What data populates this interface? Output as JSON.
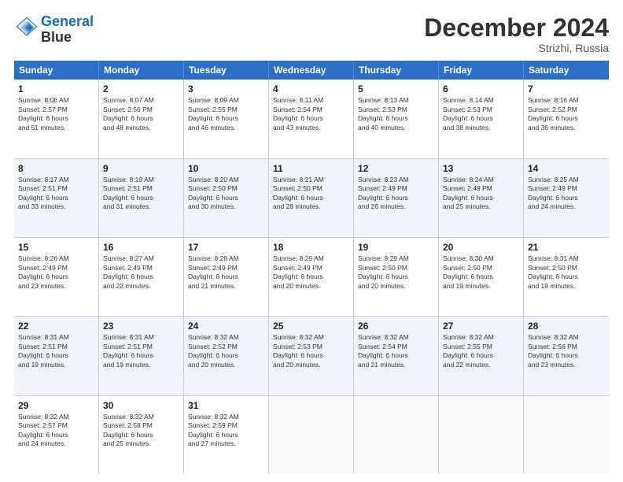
{
  "logo": {
    "line1": "General",
    "line2": "Blue"
  },
  "title": "December 2024",
  "location": "Strizhi, Russia",
  "days_of_week": [
    "Sunday",
    "Monday",
    "Tuesday",
    "Wednesday",
    "Thursday",
    "Friday",
    "Saturday"
  ],
  "weeks": [
    [
      {
        "day": "1",
        "info": "Sunrise: 8:06 AM\nSunset: 2:57 PM\nDaylight: 6 hours\nand 51 minutes."
      },
      {
        "day": "2",
        "info": "Sunrise: 8:07 AM\nSunset: 2:56 PM\nDaylight: 6 hours\nand 48 minutes."
      },
      {
        "day": "3",
        "info": "Sunrise: 8:09 AM\nSunset: 2:55 PM\nDaylight: 6 hours\nand 46 minutes."
      },
      {
        "day": "4",
        "info": "Sunrise: 8:11 AM\nSunset: 2:54 PM\nDaylight: 6 hours\nand 43 minutes."
      },
      {
        "day": "5",
        "info": "Sunrise: 8:13 AM\nSunset: 2:53 PM\nDaylight: 6 hours\nand 40 minutes."
      },
      {
        "day": "6",
        "info": "Sunrise: 8:14 AM\nSunset: 2:53 PM\nDaylight: 6 hours\nand 38 minutes."
      },
      {
        "day": "7",
        "info": "Sunrise: 8:16 AM\nSunset: 2:52 PM\nDaylight: 6 hours\nand 36 minutes."
      }
    ],
    [
      {
        "day": "8",
        "info": "Sunrise: 8:17 AM\nSunset: 2:51 PM\nDaylight: 6 hours\nand 33 minutes."
      },
      {
        "day": "9",
        "info": "Sunrise: 8:19 AM\nSunset: 2:51 PM\nDaylight: 6 hours\nand 31 minutes."
      },
      {
        "day": "10",
        "info": "Sunrise: 8:20 AM\nSunset: 2:50 PM\nDaylight: 6 hours\nand 30 minutes."
      },
      {
        "day": "11",
        "info": "Sunrise: 8:21 AM\nSunset: 2:50 PM\nDaylight: 6 hours\nand 28 minutes."
      },
      {
        "day": "12",
        "info": "Sunrise: 8:23 AM\nSunset: 2:49 PM\nDaylight: 6 hours\nand 26 minutes."
      },
      {
        "day": "13",
        "info": "Sunrise: 8:24 AM\nSunset: 2:49 PM\nDaylight: 6 hours\nand 25 minutes."
      },
      {
        "day": "14",
        "info": "Sunrise: 8:25 AM\nSunset: 2:49 PM\nDaylight: 6 hours\nand 24 minutes."
      }
    ],
    [
      {
        "day": "15",
        "info": "Sunrise: 8:26 AM\nSunset: 2:49 PM\nDaylight: 6 hours\nand 23 minutes."
      },
      {
        "day": "16",
        "info": "Sunrise: 8:27 AM\nSunset: 2:49 PM\nDaylight: 6 hours\nand 22 minutes."
      },
      {
        "day": "17",
        "info": "Sunrise: 8:28 AM\nSunset: 2:49 PM\nDaylight: 6 hours\nand 21 minutes."
      },
      {
        "day": "18",
        "info": "Sunrise: 8:29 AM\nSunset: 2:49 PM\nDaylight: 6 hours\nand 20 minutes."
      },
      {
        "day": "19",
        "info": "Sunrise: 8:29 AM\nSunset: 2:50 PM\nDaylight: 6 hours\nand 20 minutes."
      },
      {
        "day": "20",
        "info": "Sunrise: 8:30 AM\nSunset: 2:50 PM\nDaylight: 6 hours\nand 19 minutes."
      },
      {
        "day": "21",
        "info": "Sunrise: 8:31 AM\nSunset: 2:50 PM\nDaylight: 6 hours\nand 19 minutes."
      }
    ],
    [
      {
        "day": "22",
        "info": "Sunrise: 8:31 AM\nSunset: 2:51 PM\nDaylight: 6 hours\nand 19 minutes."
      },
      {
        "day": "23",
        "info": "Sunrise: 8:31 AM\nSunset: 2:51 PM\nDaylight: 6 hours\nand 19 minutes."
      },
      {
        "day": "24",
        "info": "Sunrise: 8:32 AM\nSunset: 2:52 PM\nDaylight: 6 hours\nand 20 minutes."
      },
      {
        "day": "25",
        "info": "Sunrise: 8:32 AM\nSunset: 2:53 PM\nDaylight: 6 hours\nand 20 minutes."
      },
      {
        "day": "26",
        "info": "Sunrise: 8:32 AM\nSunset: 2:54 PM\nDaylight: 6 hours\nand 21 minutes."
      },
      {
        "day": "27",
        "info": "Sunrise: 8:32 AM\nSunset: 2:55 PM\nDaylight: 6 hours\nand 22 minutes."
      },
      {
        "day": "28",
        "info": "Sunrise: 8:32 AM\nSunset: 2:56 PM\nDaylight: 6 hours\nand 23 minutes."
      }
    ],
    [
      {
        "day": "29",
        "info": "Sunrise: 8:32 AM\nSunset: 2:57 PM\nDaylight: 6 hours\nand 24 minutes."
      },
      {
        "day": "30",
        "info": "Sunrise: 8:32 AM\nSunset: 2:58 PM\nDaylight: 6 hours\nand 25 minutes."
      },
      {
        "day": "31",
        "info": "Sunrise: 8:32 AM\nSunset: 2:59 PM\nDaylight: 6 hours\nand 27 minutes."
      },
      {
        "day": "",
        "info": ""
      },
      {
        "day": "",
        "info": ""
      },
      {
        "day": "",
        "info": ""
      },
      {
        "day": "",
        "info": ""
      }
    ]
  ]
}
